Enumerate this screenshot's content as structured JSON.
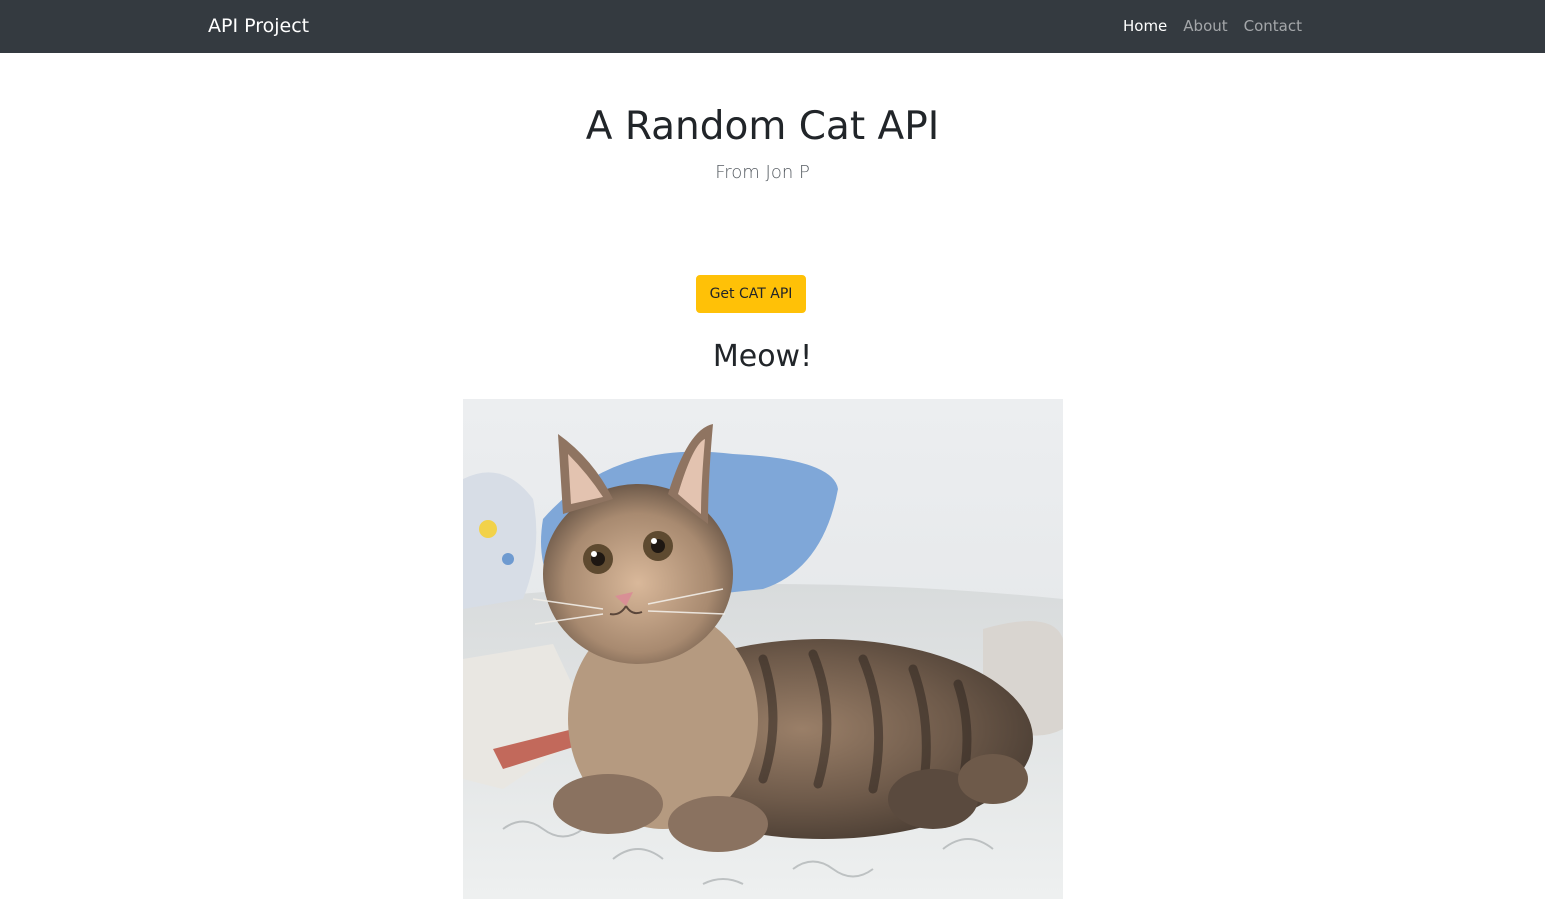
{
  "navbar": {
    "brand": "API Project",
    "links": [
      {
        "label": "Home",
        "active": true
      },
      {
        "label": "About",
        "active": false
      },
      {
        "label": "Contact",
        "active": false
      }
    ]
  },
  "hero": {
    "title": "A Random Cat API",
    "subtitle": "From Jon P"
  },
  "action": {
    "button_label": "Get CAT API"
  },
  "result": {
    "heading": "Meow!",
    "image_alt": "cat photo"
  },
  "colors": {
    "navbar_bg": "#343a40",
    "button_bg": "#ffc107"
  }
}
